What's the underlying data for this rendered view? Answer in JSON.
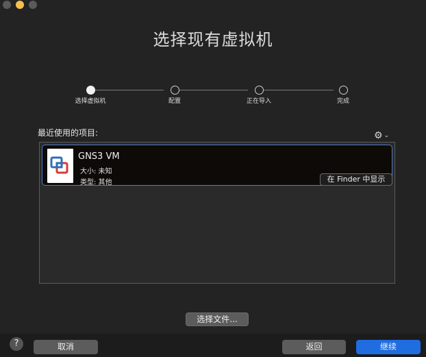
{
  "window": {
    "title": "选择现有虚拟机"
  },
  "steps": [
    {
      "label": "选择虚拟机",
      "active": true
    },
    {
      "label": "配置",
      "active": false
    },
    {
      "label": "正在导入",
      "active": false
    },
    {
      "label": "完成",
      "active": false
    }
  ],
  "recent": {
    "label": "最近使用的项目:",
    "items": [
      {
        "name": "GNS3 VM",
        "size": "大小: 未知",
        "type": "类型: 其他",
        "show_in_finder": "在 Finder 中显示"
      }
    ]
  },
  "buttons": {
    "choose_file": "选择文件...",
    "help": "?",
    "cancel": "取消",
    "back": "返回",
    "continue": "继续"
  },
  "colors": {
    "accent": "#1f6de0",
    "selection_border": "#4f7ed1",
    "background": "#232323"
  }
}
